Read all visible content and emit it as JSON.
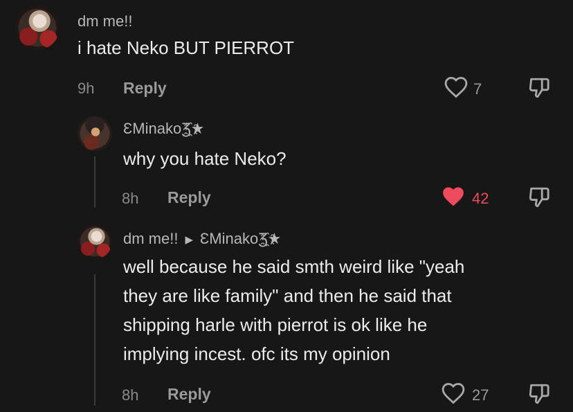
{
  "comments": [
    {
      "username": "dm me!!",
      "text": "i hate Neko BUT PIERROT",
      "time": "9h",
      "reply_label": "Reply",
      "likes": "7",
      "liked": false
    },
    {
      "username": "ƐMinakoƷ҈★",
      "text": "why you hate Neko?",
      "time": "8h",
      "reply_label": "Reply",
      "likes": "42",
      "liked": true
    },
    {
      "username": "dm me!!",
      "reply_to": "ƐMinakoƷ҈★",
      "text": "well because he said smth weird like \"yeah\nthey are like family\" and then he said that\nshipping harle with pierrot is ok like he\nimplying incest. ofc its my opinion",
      "time": "8h",
      "reply_label": "Reply",
      "likes": "27",
      "liked": false
    }
  ],
  "icons": {
    "like": "heart-icon",
    "liked": "heart-filled-icon",
    "dislike": "thumbs-down-icon",
    "reply_arrow": "play-arrow-icon"
  },
  "colors": {
    "background": "#171717",
    "liked": "#f04a5e"
  }
}
